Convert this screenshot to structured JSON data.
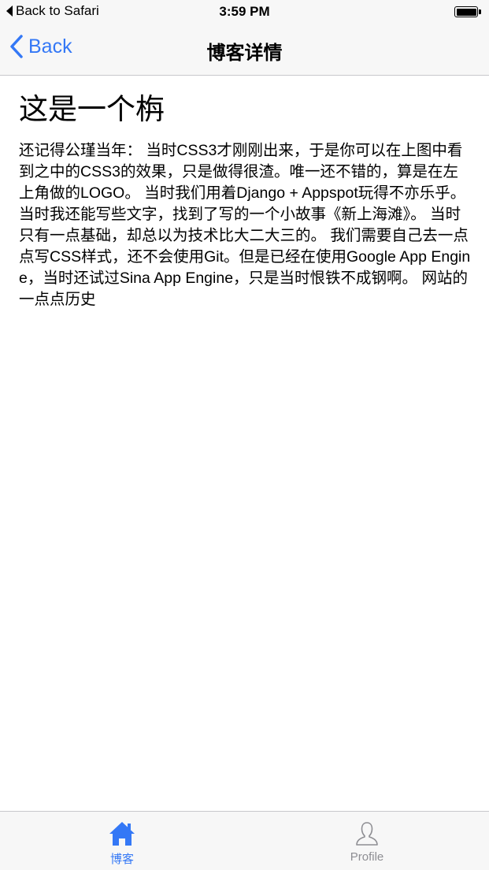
{
  "status_bar": {
    "back_app": "Back to Safari",
    "time": "3:59 PM"
  },
  "nav": {
    "back_label": "Back",
    "title": "博客详情"
  },
  "post": {
    "title": "这是一个栴",
    "body": "还记得公瑾当年：  当时CSS3才刚刚出来，于是你可以在上图中看到之中的CSS3的效果，只是做得很渣。唯一还不错的，算是在左上角做的LOGO。  当时我们用着Django + Appspot玩得不亦乐乎。  当时我还能写些文字，找到了写的一个小故事《新上海滩》。  当时只有一点基础，却总以为技术比大二大三的。   我们需要自己去一点点写CSS样式，还不会使用Git。但是已经在使用Google App Engine，当时还试过Sina App Engine，只是当时恨铁不成钢啊。   网站的一点点历史"
  },
  "tabs": [
    {
      "label": "博客",
      "icon": "home-icon",
      "active": true
    },
    {
      "label": "Profile",
      "icon": "person-icon",
      "active": false
    }
  ],
  "colors": {
    "accent": "#3478f6",
    "inactive": "#8e8e93",
    "bar_background": "#f7f7f7"
  }
}
